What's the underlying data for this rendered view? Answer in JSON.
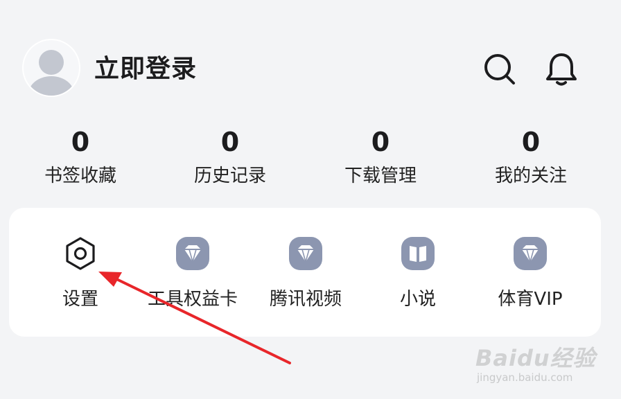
{
  "header": {
    "login_label": "立即登录"
  },
  "stats": [
    {
      "count": "0",
      "label": "书签收藏"
    },
    {
      "count": "0",
      "label": "历史记录"
    },
    {
      "count": "0",
      "label": "下载管理"
    },
    {
      "count": "0",
      "label": "我的关注"
    }
  ],
  "tools": [
    {
      "label": "设置",
      "icon": "settings-icon"
    },
    {
      "label": "工具权益卡",
      "icon": "diamond-icon"
    },
    {
      "label": "腾讯视频",
      "icon": "diamond-icon"
    },
    {
      "label": "小说",
      "icon": "book-icon"
    },
    {
      "label": "体育VIP",
      "icon": "diamond-icon"
    }
  ],
  "watermark": {
    "brand": "Baidu经验",
    "url": "jingyan.baidu.com"
  },
  "colors": {
    "background": "#f3f4f6",
    "card": "#ffffff",
    "icon_badge": "#8c96b0",
    "annotation_arrow": "#e8262a"
  }
}
